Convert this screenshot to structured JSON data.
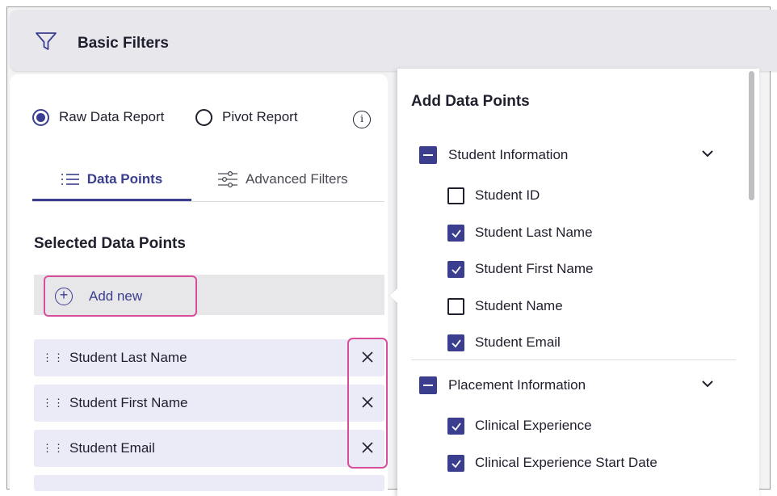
{
  "header": {
    "title": "Basic Filters",
    "icon": "filter-icon"
  },
  "report_type": {
    "options": [
      {
        "label": "Raw Data Report",
        "selected": true
      },
      {
        "label": "Pivot Report",
        "selected": false
      }
    ],
    "info_glyph": "i"
  },
  "tabs": [
    {
      "label": "Data Points",
      "active": true,
      "icon": "list-icon"
    },
    {
      "label": "Advanced Filters",
      "active": false,
      "icon": "sliders-icon"
    }
  ],
  "selected": {
    "title": "Selected Data Points",
    "add_new_label": "Add new",
    "items": [
      "Student Last Name",
      "Student First Name",
      "Student Email"
    ]
  },
  "dropdown": {
    "title": "Add Data Points",
    "groups": [
      {
        "label": "Student Information",
        "items": [
          {
            "label": "Student ID",
            "checked": false
          },
          {
            "label": "Student Last Name",
            "checked": true
          },
          {
            "label": "Student First Name",
            "checked": true
          },
          {
            "label": "Student Name",
            "checked": false
          },
          {
            "label": "Student Email",
            "checked": true
          }
        ]
      },
      {
        "label": "Placement Information",
        "items": [
          {
            "label": "Clinical Experience",
            "checked": true
          },
          {
            "label": "Clinical Experience Start Date",
            "checked": true
          }
        ]
      }
    ]
  },
  "colors": {
    "accent": "#3b3e8f",
    "highlight": "#d84d9b",
    "row_bg": "#ebebf7"
  }
}
